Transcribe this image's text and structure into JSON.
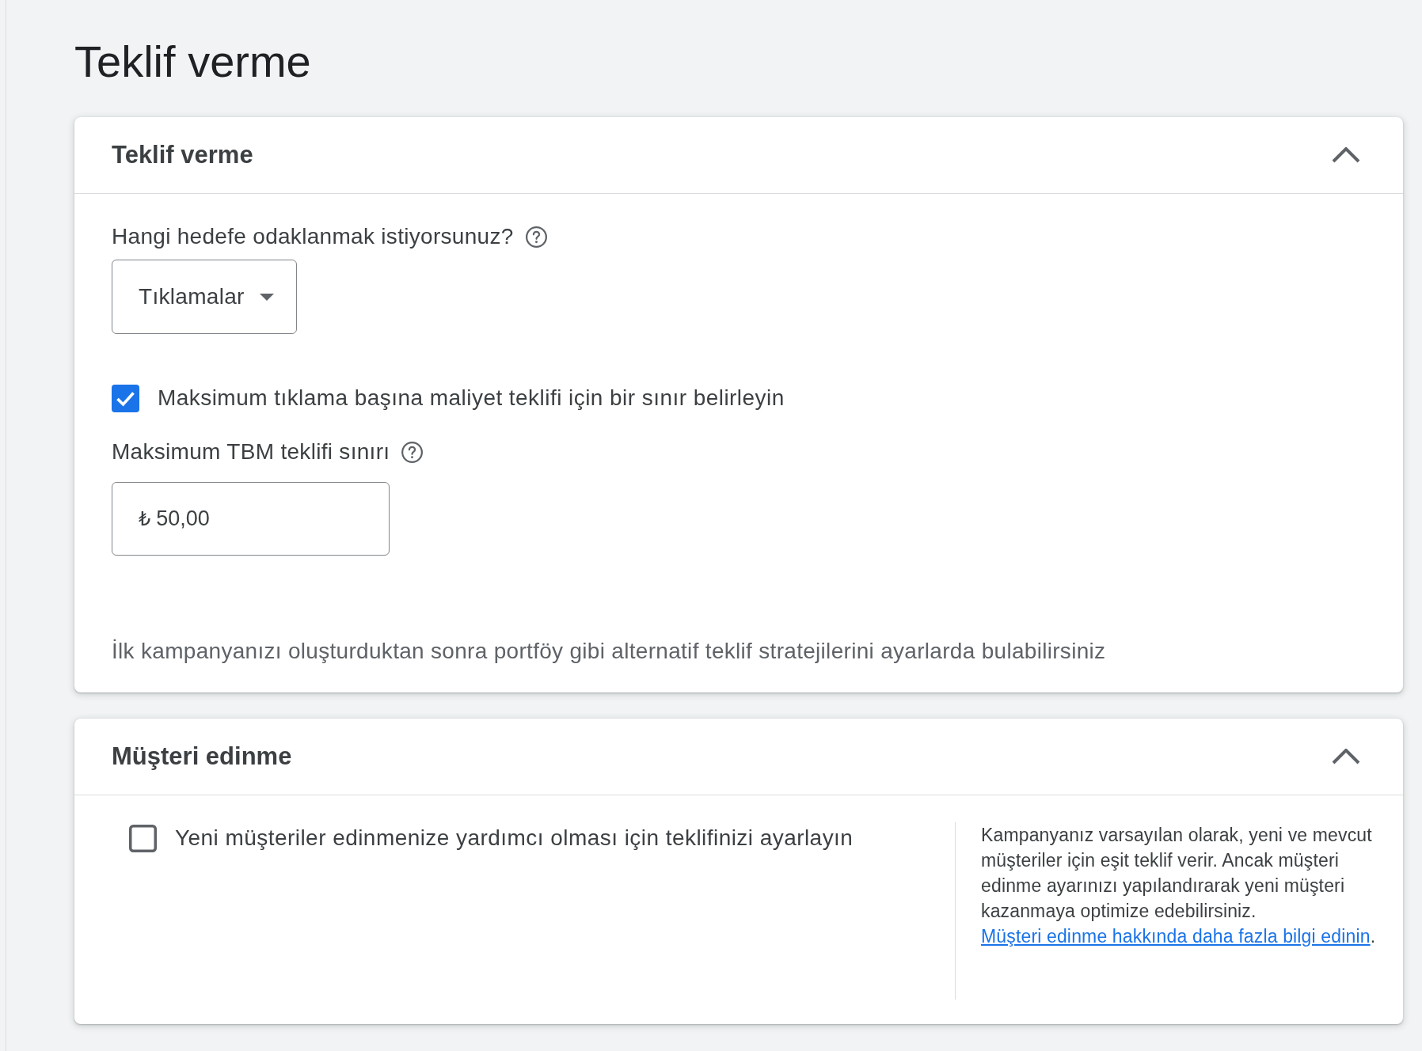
{
  "page_title": "Teklif verme",
  "sections": [
    {
      "title": "Teklif verme",
      "expanded": true,
      "items": [
        {
          "kind": "label",
          "text": "Hangi hedefe odaklanmak istiyorsunuz?",
          "help": true
        },
        {
          "kind": "dropdown",
          "value": "Tıklamalar"
        },
        {
          "kind": "checkbox",
          "label": "Maksimum tıklama başına maliyet teklifi için bir sınır belirleyin",
          "checked": true
        },
        {
          "kind": "label",
          "text": "Maksimum TBM teklifi sınırı",
          "help": true
        },
        {
          "kind": "input",
          "prefix": "₺",
          "value": "50,00"
        },
        {
          "kind": "note",
          "text": "İlk kampanyanızı oluşturduktan sonra portföy gibi alternatif teklif stratejilerini ayarlarda bulabilirsiniz"
        }
      ]
    },
    {
      "title": "Müşteri edinme",
      "expanded": true,
      "items": [
        {
          "kind": "checkbox",
          "label": "Yeni müşteriler edinmenize yardımcı olması için teklifinizi ayarlayın",
          "checked": false
        }
      ],
      "aside": {
        "text": "Kampanyanız varsayılan olarak, yeni ve mevcut müşteriler için eşit teklif verir. Ancak müşteri edinme ayarınızı yapılandırarak yeni müşteri kazanmaya optimize edebilirsiniz.",
        "link": "Müşteri edinme hakkında daha fazla bilgi edinin",
        "link_suffix": "."
      }
    }
  ]
}
